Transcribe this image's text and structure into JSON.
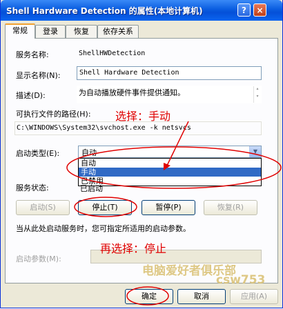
{
  "window": {
    "title": "Shell Hardware Detection 的属性(本地计算机)",
    "help_glyph": "?",
    "close_glyph": "×"
  },
  "tabs": [
    "常规",
    "登录",
    "恢复",
    "依存关系"
  ],
  "general": {
    "service_name_label": "服务名称:",
    "service_name_value": "ShellHWDetection",
    "display_name_label": "显示名称(N):",
    "display_name_value": "Shell Hardware Detection",
    "description_label": "描述(D):",
    "description_value": "为自动播放硬件事件提供通知。",
    "exe_path_label": "可执行文件的路径(H):",
    "exe_path_value": "C:\\WINDOWS\\System32\\svchost.exe -k netsvcs",
    "startup_type_label": "启动类型(E):",
    "startup_type_value": "自动",
    "startup_options": [
      "自动",
      "手动",
      "已禁用"
    ],
    "startup_selected_index": 1,
    "service_status_label": "服务状态:",
    "service_status_value": "已启动",
    "buttons": {
      "start": "启动(S)",
      "stop": "停止(T)",
      "pause": "暂停(P)",
      "resume": "恢复(R)"
    },
    "hint_text": "当从此处启动服务时，您可指定所适用的启动参数。",
    "start_params_label": "启动参数(M):"
  },
  "annotations": {
    "select_manual": "选择：手动",
    "then_select_stop": "再选择：停止"
  },
  "watermark": {
    "line1": "电脑爱好者俱乐部",
    "line2": "csw753"
  },
  "footer": {
    "ok": "确定",
    "cancel": "取消",
    "apply": "应用(A)"
  },
  "colors": {
    "annotation": "#e00000",
    "title_bar": "#0a5de0",
    "selection": "#316ac5"
  }
}
